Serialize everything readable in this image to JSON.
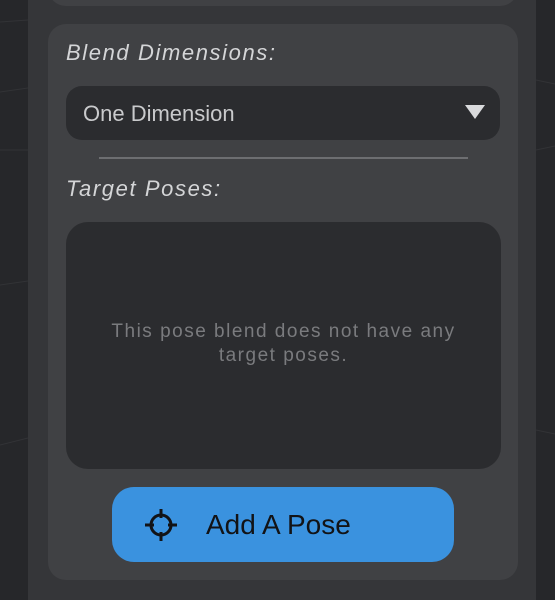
{
  "blend_dimensions": {
    "label": "Blend Dimensions:",
    "selected_value": "One Dimension",
    "caret_icon": "triangle-down-icon"
  },
  "target_poses": {
    "label": "Target Poses:",
    "empty_message": "This pose blend does not have any target poses."
  },
  "add_pose_button": {
    "label": "Add A Pose",
    "icon": "crosshair-target-icon"
  },
  "colors": {
    "page_background": "#26272a",
    "panel": "#353639",
    "card": "#404144",
    "inset": "#2b2c2f",
    "accent_button": "#3a92df",
    "label_text": "#d4d5d7",
    "muted_text": "#7a7b7e"
  }
}
